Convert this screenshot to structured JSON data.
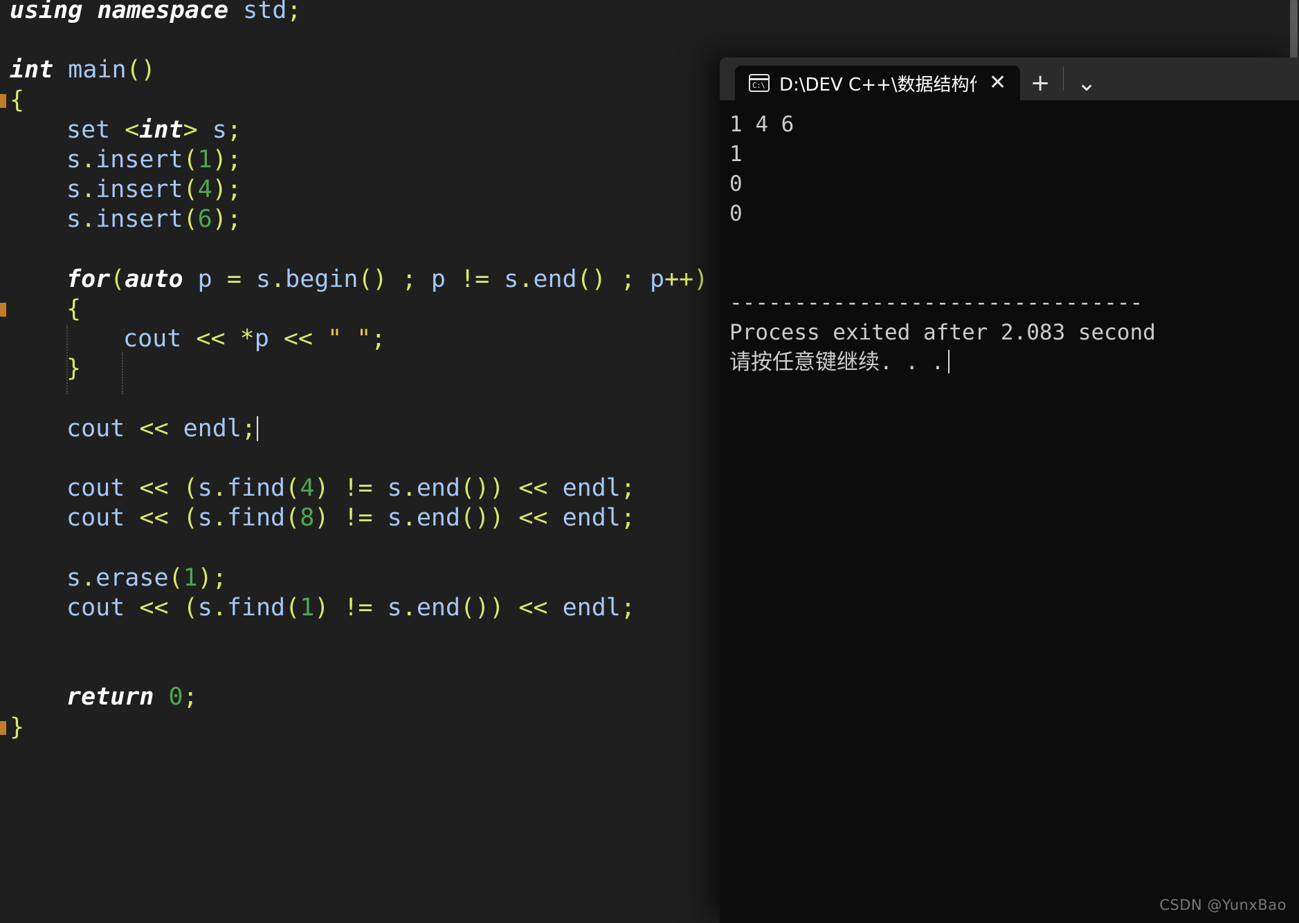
{
  "editor": {
    "language": "cpp",
    "background": "#1f1f1f",
    "colors": {
      "keyword": "#ffffff",
      "identifier": "#a6c8f5",
      "punctuation": "#d9e86a",
      "number": "#4fa64f",
      "string": "#e8c547",
      "fold_marker": "#c07d27"
    },
    "code_lines": [
      {
        "id": 1,
        "indent": 0,
        "tokens": [
          {
            "t": "using",
            "c": "kw"
          },
          {
            "t": " ",
            "c": "plain"
          },
          {
            "t": "namespace",
            "c": "kw"
          },
          {
            "t": " ",
            "c": "plain"
          },
          {
            "t": "std",
            "c": "id"
          },
          {
            "t": ";",
            "c": "punc"
          }
        ]
      },
      {
        "id": 2,
        "indent": 0,
        "tokens": []
      },
      {
        "id": 3,
        "indent": 0,
        "tokens": [
          {
            "t": "int",
            "c": "kw"
          },
          {
            "t": " ",
            "c": "plain"
          },
          {
            "t": "main",
            "c": "id"
          },
          {
            "t": "()",
            "c": "punc"
          }
        ]
      },
      {
        "id": 4,
        "indent": 0,
        "fold": true,
        "tokens": [
          {
            "t": "{",
            "c": "punc"
          }
        ]
      },
      {
        "id": 5,
        "indent": 1,
        "tokens": [
          {
            "t": "set",
            "c": "id"
          },
          {
            "t": " ",
            "c": "plain"
          },
          {
            "t": "<",
            "c": "punc"
          },
          {
            "t": "int",
            "c": "kw"
          },
          {
            "t": ">",
            "c": "punc"
          },
          {
            "t": " ",
            "c": "plain"
          },
          {
            "t": "s",
            "c": "id"
          },
          {
            "t": ";",
            "c": "punc"
          }
        ]
      },
      {
        "id": 6,
        "indent": 1,
        "tokens": [
          {
            "t": "s",
            "c": "id"
          },
          {
            "t": ".",
            "c": "punc"
          },
          {
            "t": "insert",
            "c": "id"
          },
          {
            "t": "(",
            "c": "punc"
          },
          {
            "t": "1",
            "c": "num"
          },
          {
            "t": ")",
            "c": "punc"
          },
          {
            "t": ";",
            "c": "punc"
          }
        ]
      },
      {
        "id": 7,
        "indent": 1,
        "tokens": [
          {
            "t": "s",
            "c": "id"
          },
          {
            "t": ".",
            "c": "punc"
          },
          {
            "t": "insert",
            "c": "id"
          },
          {
            "t": "(",
            "c": "punc"
          },
          {
            "t": "4",
            "c": "num"
          },
          {
            "t": ")",
            "c": "punc"
          },
          {
            "t": ";",
            "c": "punc"
          }
        ]
      },
      {
        "id": 8,
        "indent": 1,
        "tokens": [
          {
            "t": "s",
            "c": "id"
          },
          {
            "t": ".",
            "c": "punc"
          },
          {
            "t": "insert",
            "c": "id"
          },
          {
            "t": "(",
            "c": "punc"
          },
          {
            "t": "6",
            "c": "num"
          },
          {
            "t": ")",
            "c": "punc"
          },
          {
            "t": ";",
            "c": "punc"
          }
        ]
      },
      {
        "id": 9,
        "indent": 0,
        "tokens": []
      },
      {
        "id": 10,
        "indent": 1,
        "tokens": [
          {
            "t": "for",
            "c": "kw"
          },
          {
            "t": "(",
            "c": "punc"
          },
          {
            "t": "auto",
            "c": "kw"
          },
          {
            "t": " p ",
            "c": "id"
          },
          {
            "t": "=",
            "c": "punc"
          },
          {
            "t": " s",
            "c": "id"
          },
          {
            "t": ".",
            "c": "punc"
          },
          {
            "t": "begin",
            "c": "id"
          },
          {
            "t": "()",
            "c": "punc"
          },
          {
            "t": " ",
            "c": "plain"
          },
          {
            "t": ";",
            "c": "punc"
          },
          {
            "t": " p ",
            "c": "id"
          },
          {
            "t": "!=",
            "c": "punc"
          },
          {
            "t": " s",
            "c": "id"
          },
          {
            "t": ".",
            "c": "punc"
          },
          {
            "t": "end",
            "c": "id"
          },
          {
            "t": "()",
            "c": "punc"
          },
          {
            "t": " ",
            "c": "plain"
          },
          {
            "t": ";",
            "c": "punc"
          },
          {
            "t": " p",
            "c": "id"
          },
          {
            "t": "++)",
            "c": "punc"
          }
        ]
      },
      {
        "id": 11,
        "indent": 1,
        "fold": true,
        "tokens": [
          {
            "t": "{",
            "c": "punc"
          }
        ]
      },
      {
        "id": 12,
        "indent": 2,
        "tokens": [
          {
            "t": "cout",
            "c": "id"
          },
          {
            "t": " ",
            "c": "plain"
          },
          {
            "t": "<<",
            "c": "punc"
          },
          {
            "t": " ",
            "c": "plain"
          },
          {
            "t": "*",
            "c": "punc"
          },
          {
            "t": "p",
            "c": "id"
          },
          {
            "t": " ",
            "c": "plain"
          },
          {
            "t": "<<",
            "c": "punc"
          },
          {
            "t": " ",
            "c": "plain"
          },
          {
            "t": "\" \"",
            "c": "str"
          },
          {
            "t": ";",
            "c": "punc"
          }
        ]
      },
      {
        "id": 13,
        "indent": 1,
        "tokens": [
          {
            "t": "}",
            "c": "punc"
          }
        ]
      },
      {
        "id": 14,
        "indent": 0,
        "tokens": []
      },
      {
        "id": 15,
        "indent": 1,
        "caret": true,
        "tokens": [
          {
            "t": "cout",
            "c": "id"
          },
          {
            "t": " ",
            "c": "plain"
          },
          {
            "t": "<<",
            "c": "punc"
          },
          {
            "t": " ",
            "c": "plain"
          },
          {
            "t": "endl",
            "c": "id"
          },
          {
            "t": ";",
            "c": "punc"
          }
        ]
      },
      {
        "id": 16,
        "indent": 0,
        "tokens": []
      },
      {
        "id": 17,
        "indent": 1,
        "tokens": [
          {
            "t": "cout",
            "c": "id"
          },
          {
            "t": " ",
            "c": "plain"
          },
          {
            "t": "<<",
            "c": "punc"
          },
          {
            "t": " ",
            "c": "plain"
          },
          {
            "t": "(",
            "c": "punc"
          },
          {
            "t": "s",
            "c": "id"
          },
          {
            "t": ".",
            "c": "punc"
          },
          {
            "t": "find",
            "c": "id"
          },
          {
            "t": "(",
            "c": "punc"
          },
          {
            "t": "4",
            "c": "num"
          },
          {
            "t": ")",
            "c": "punc"
          },
          {
            "t": " ",
            "c": "plain"
          },
          {
            "t": "!=",
            "c": "punc"
          },
          {
            "t": " s",
            "c": "id"
          },
          {
            "t": ".",
            "c": "punc"
          },
          {
            "t": "end",
            "c": "id"
          },
          {
            "t": "())",
            "c": "punc"
          },
          {
            "t": " ",
            "c": "plain"
          },
          {
            "t": "<<",
            "c": "punc"
          },
          {
            "t": " ",
            "c": "plain"
          },
          {
            "t": "endl",
            "c": "id"
          },
          {
            "t": ";",
            "c": "punc"
          }
        ]
      },
      {
        "id": 18,
        "indent": 1,
        "tokens": [
          {
            "t": "cout",
            "c": "id"
          },
          {
            "t": " ",
            "c": "plain"
          },
          {
            "t": "<<",
            "c": "punc"
          },
          {
            "t": " ",
            "c": "plain"
          },
          {
            "t": "(",
            "c": "punc"
          },
          {
            "t": "s",
            "c": "id"
          },
          {
            "t": ".",
            "c": "punc"
          },
          {
            "t": "find",
            "c": "id"
          },
          {
            "t": "(",
            "c": "punc"
          },
          {
            "t": "8",
            "c": "num"
          },
          {
            "t": ")",
            "c": "punc"
          },
          {
            "t": " ",
            "c": "plain"
          },
          {
            "t": "!=",
            "c": "punc"
          },
          {
            "t": " s",
            "c": "id"
          },
          {
            "t": ".",
            "c": "punc"
          },
          {
            "t": "end",
            "c": "id"
          },
          {
            "t": "())",
            "c": "punc"
          },
          {
            "t": " ",
            "c": "plain"
          },
          {
            "t": "<<",
            "c": "punc"
          },
          {
            "t": " ",
            "c": "plain"
          },
          {
            "t": "endl",
            "c": "id"
          },
          {
            "t": ";",
            "c": "punc"
          }
        ]
      },
      {
        "id": 19,
        "indent": 0,
        "tokens": []
      },
      {
        "id": 20,
        "indent": 1,
        "tokens": [
          {
            "t": "s",
            "c": "id"
          },
          {
            "t": ".",
            "c": "punc"
          },
          {
            "t": "erase",
            "c": "id"
          },
          {
            "t": "(",
            "c": "punc"
          },
          {
            "t": "1",
            "c": "num"
          },
          {
            "t": ")",
            "c": "punc"
          },
          {
            "t": ";",
            "c": "punc"
          }
        ]
      },
      {
        "id": 21,
        "indent": 1,
        "tokens": [
          {
            "t": "cout",
            "c": "id"
          },
          {
            "t": " ",
            "c": "plain"
          },
          {
            "t": "<<",
            "c": "punc"
          },
          {
            "t": " ",
            "c": "plain"
          },
          {
            "t": "(",
            "c": "punc"
          },
          {
            "t": "s",
            "c": "id"
          },
          {
            "t": ".",
            "c": "punc"
          },
          {
            "t": "find",
            "c": "id"
          },
          {
            "t": "(",
            "c": "punc"
          },
          {
            "t": "1",
            "c": "num"
          },
          {
            "t": ")",
            "c": "punc"
          },
          {
            "t": " ",
            "c": "plain"
          },
          {
            "t": "!=",
            "c": "punc"
          },
          {
            "t": " s",
            "c": "id"
          },
          {
            "t": ".",
            "c": "punc"
          },
          {
            "t": "end",
            "c": "id"
          },
          {
            "t": "())",
            "c": "punc"
          },
          {
            "t": " ",
            "c": "plain"
          },
          {
            "t": "<<",
            "c": "punc"
          },
          {
            "t": " ",
            "c": "plain"
          },
          {
            "t": "endl",
            "c": "id"
          },
          {
            "t": ";",
            "c": "punc"
          }
        ]
      },
      {
        "id": 22,
        "indent": 0,
        "tokens": []
      },
      {
        "id": 23,
        "indent": 0,
        "tokens": []
      },
      {
        "id": 24,
        "indent": 1,
        "tokens": [
          {
            "t": "return",
            "c": "kw"
          },
          {
            "t": " ",
            "c": "plain"
          },
          {
            "t": "0",
            "c": "num"
          },
          {
            "t": ";",
            "c": "punc"
          }
        ]
      },
      {
        "id": 25,
        "indent": 0,
        "fold": true,
        "tokens": [
          {
            "t": "}",
            "c": "punc"
          }
        ]
      }
    ]
  },
  "terminal": {
    "tab": {
      "icon": "console-icon",
      "icon_text": "C:\\",
      "title": "D:\\DEV C++\\数据结构作业\\图",
      "close_label": "✕"
    },
    "new_tab_label": "+",
    "dropdown_label": "⌄",
    "output_lines": [
      "1 4 6",
      "1",
      "0",
      "0",
      "",
      "",
      "--------------------------------",
      "Process exited after 2.083 second",
      "请按任意键继续. . ."
    ],
    "cursor_on_last_line": true
  },
  "watermark": {
    "text": "CSDN @YunxBao"
  }
}
